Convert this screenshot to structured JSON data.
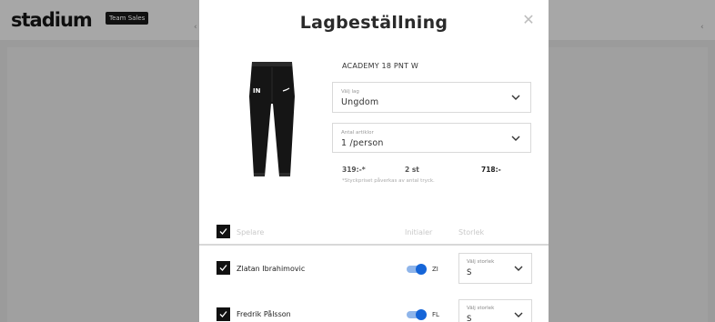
{
  "background": {
    "logo": "stadium",
    "badge": "Team Sales"
  },
  "modal": {
    "title": "Lagbeställning",
    "close_icon": "close-icon",
    "product": {
      "name": "ACADEMY 18 PNT W",
      "image_letters": "IN"
    },
    "team_select": {
      "label": "Välj lag",
      "value": "Ungdom"
    },
    "quantity_select": {
      "label": "Antal artiklor",
      "value": "1 /person"
    },
    "pricing": {
      "unit_price": "319:-*",
      "quantity": "2 st",
      "total": "718:-",
      "note": "*Styckpriset påverkas av antal tryck."
    },
    "table": {
      "headers": {
        "player": "Spelare",
        "initials": "Initialer",
        "size": "Storlek"
      },
      "rows": [
        {
          "name": "Zlatan Ibrahimovic",
          "initials": "ZI",
          "size_label": "Välj storlek",
          "size": "S",
          "checked": true,
          "initials_on": true
        },
        {
          "name": "Fredrik Pålsson",
          "initials": "FL",
          "size_label": "Välj storlek",
          "size": "S",
          "checked": true,
          "initials_on": true
        }
      ]
    }
  },
  "colors": {
    "toggle_track": "#8fb5ea",
    "toggle_knob": "#1565d8",
    "overlay": "#9b9b9b"
  }
}
